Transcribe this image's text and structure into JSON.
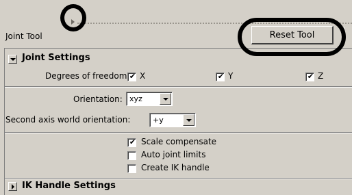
{
  "tool": {
    "title": "Joint Tool",
    "reset_label": "Reset Tool"
  },
  "joint_settings": {
    "title": "Joint Settings",
    "dof_label": "Degrees of freedom:",
    "dof": [
      {
        "label": "X",
        "checked": true
      },
      {
        "label": "Y",
        "checked": true
      },
      {
        "label": "Z",
        "checked": true
      }
    ],
    "orientation_label": "Orientation:",
    "orientation_value": "xyz",
    "second_axis_label": "Second axis world orientation:",
    "second_axis_value": "+y",
    "options": [
      {
        "label": "Scale compensate",
        "checked": true
      },
      {
        "label": "Auto joint limits",
        "checked": false
      },
      {
        "label": "Create IK handle",
        "checked": false
      }
    ]
  },
  "ik_settings": {
    "title": "IK Handle Settings"
  },
  "icons": {
    "expanded": "triangle-down-icon",
    "collapsed": "triangle-right-icon",
    "check": "checkmark-icon"
  },
  "colors": {
    "panel": "#d4d0c8",
    "annotation": "#000000"
  }
}
